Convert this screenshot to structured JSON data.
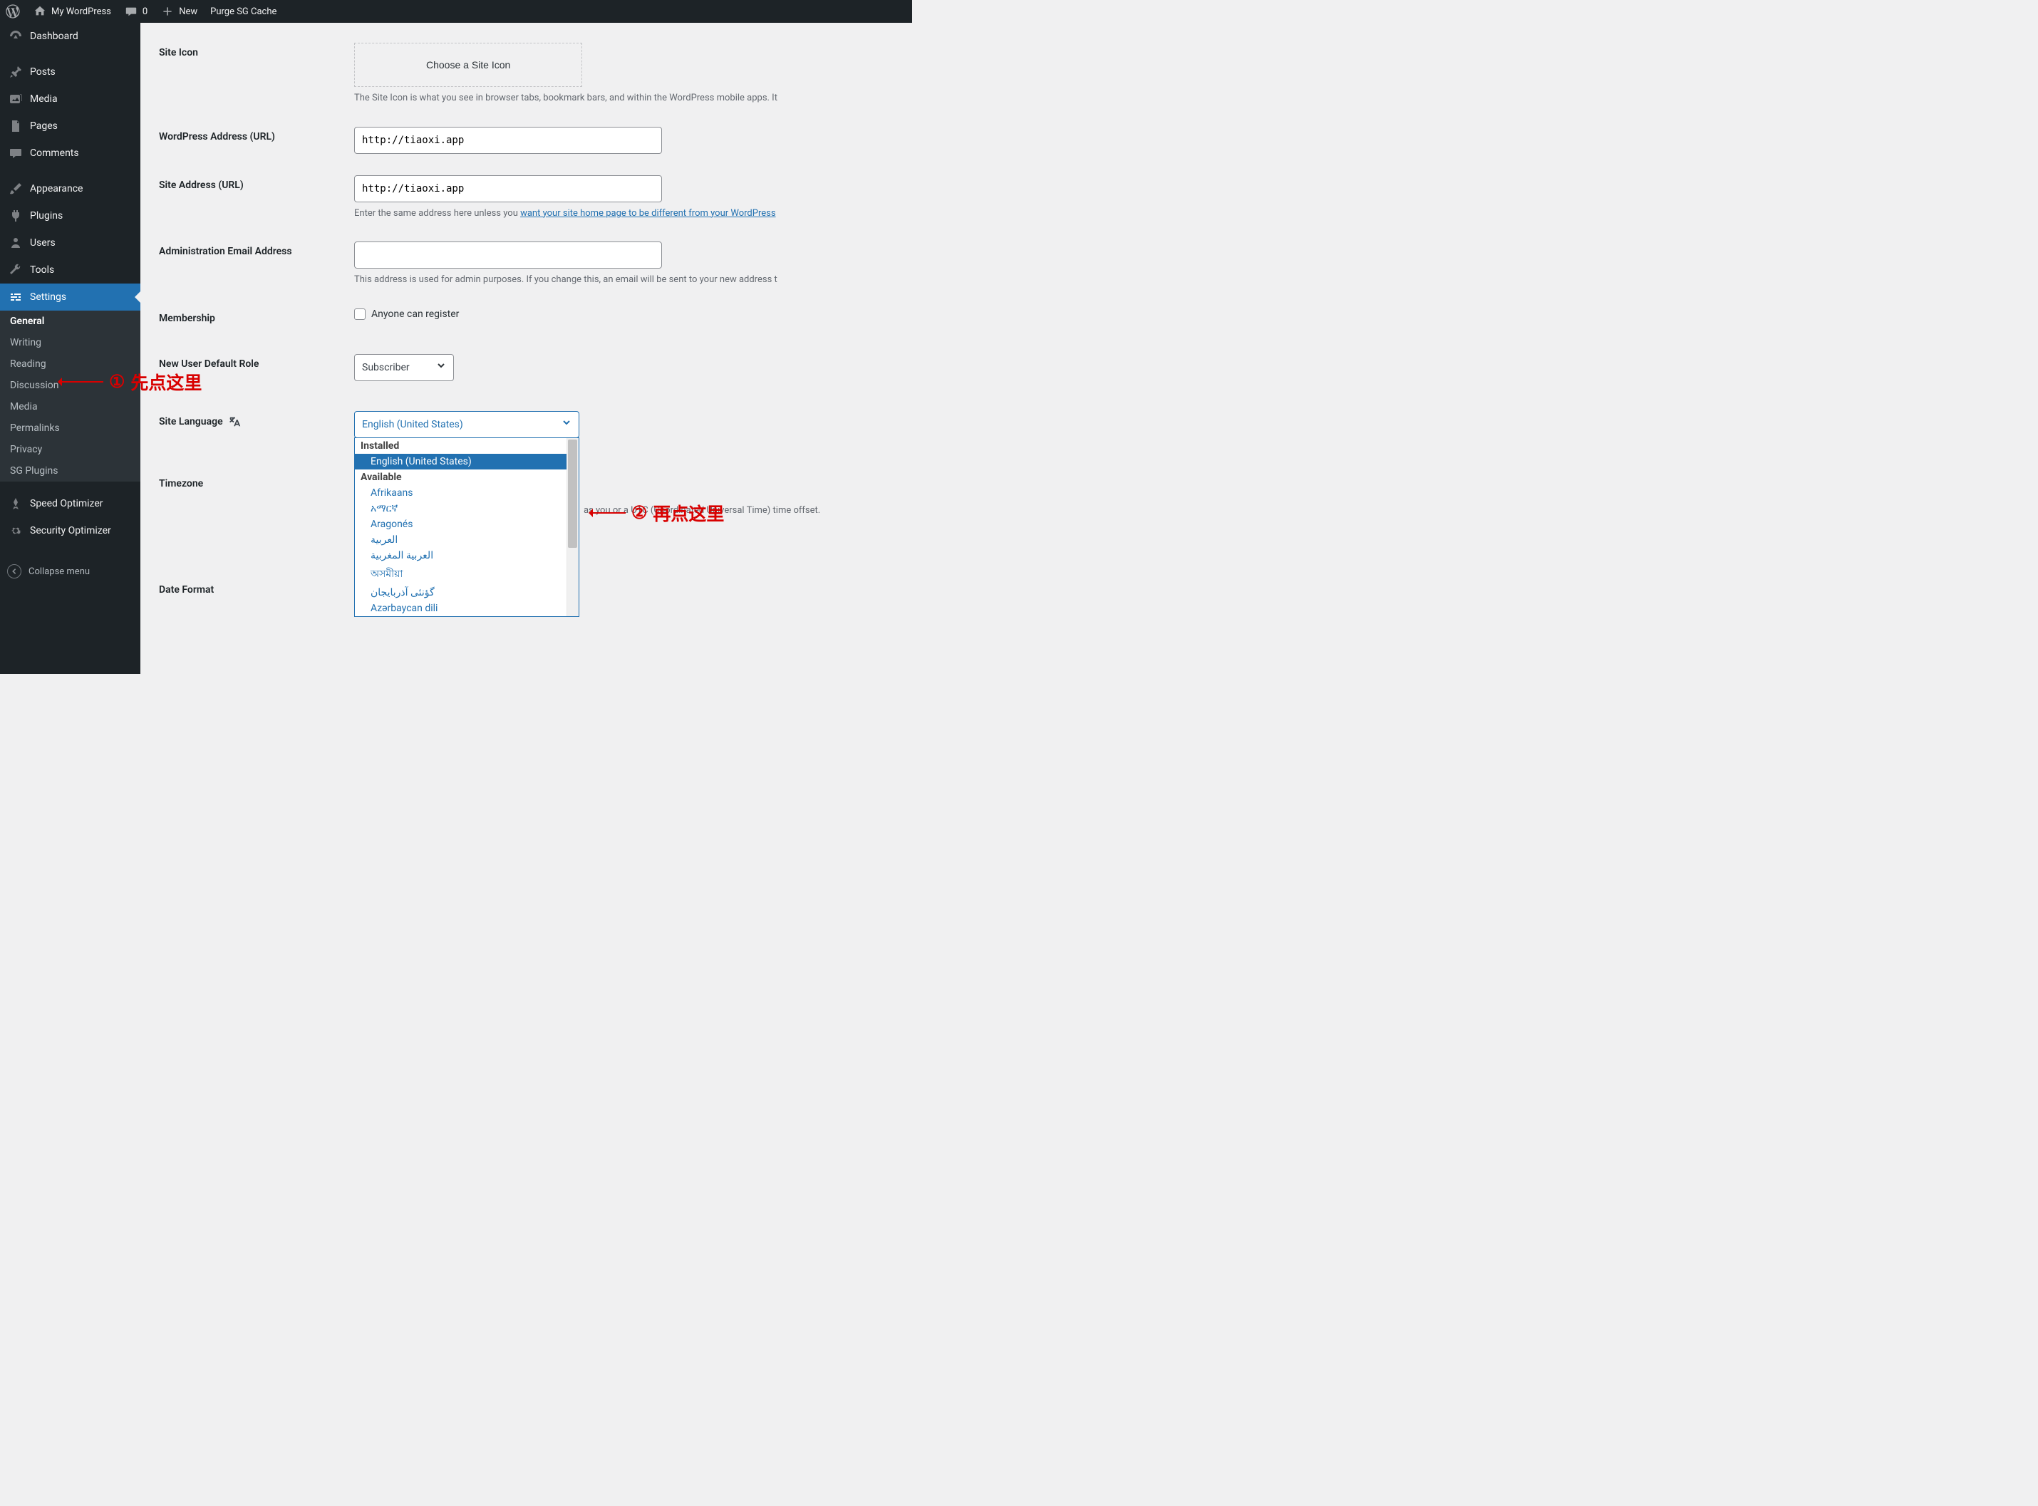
{
  "adminbar": {
    "site_name": "My WordPress",
    "comments_count": "0",
    "new_label": "New",
    "purge_label": "Purge SG Cache"
  },
  "sidebar": {
    "dashboard": "Dashboard",
    "posts": "Posts",
    "media": "Media",
    "pages": "Pages",
    "comments": "Comments",
    "appearance": "Appearance",
    "plugins": "Plugins",
    "users": "Users",
    "tools": "Tools",
    "settings": "Settings",
    "settings_sub": {
      "general": "General",
      "writing": "Writing",
      "reading": "Reading",
      "discussion": "Discussion",
      "media": "Media",
      "permalinks": "Permalinks",
      "privacy": "Privacy",
      "sg_plugins": "SG Plugins"
    },
    "speed_optimizer": "Speed Optimizer",
    "security_optimizer": "Security Optimizer",
    "collapse": "Collapse menu"
  },
  "form": {
    "site_icon_label": "Site Icon",
    "choose_site_icon_btn": "Choose a Site Icon",
    "site_icon_desc": "The Site Icon is what you see in browser tabs, bookmark bars, and within the WordPress mobile apps. It",
    "wp_url_label": "WordPress Address (URL)",
    "wp_url_value": "http://tiaoxi.app",
    "site_url_label": "Site Address (URL)",
    "site_url_value": "http://tiaoxi.app",
    "site_url_desc_pre": "Enter the same address here unless you ",
    "site_url_desc_link": "want your site home page to be different from your WordPress",
    "admin_email_label": "Administration Email Address",
    "admin_email_value": "",
    "admin_email_desc": "This address is used for admin purposes. If you change this, an email will be sent to your new address t",
    "membership_label": "Membership",
    "membership_check_label": "Anyone can register",
    "new_user_role_label": "New User Default Role",
    "new_user_role_value": "Subscriber",
    "site_language_label": "Site Language",
    "site_language_value": "English (United States)",
    "timezone_label": "Timezone",
    "timezone_desc": "as you or a UTC (Coordinated Universal Time) time offset.",
    "date_format_label": "Date Format"
  },
  "language_dropdown": {
    "group_installed": "Installed",
    "opt_en_us": "English (United States)",
    "group_available": "Available",
    "opts": [
      "Afrikaans",
      "አማርኛ",
      "Aragonés",
      "العربية",
      "العربية المغربية",
      "অসমীয়া",
      "گؤنئی آذربایجان",
      "Azərbaycan dili"
    ]
  },
  "annotations": {
    "a1_num": "①",
    "a1_text": "先点这里",
    "a2_num": "②",
    "a2_text": "再点这里"
  }
}
